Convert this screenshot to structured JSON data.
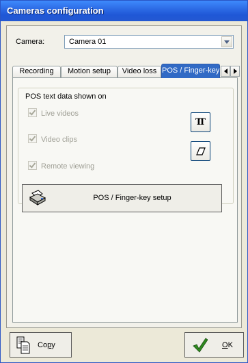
{
  "window": {
    "title": "Cameras configuration"
  },
  "camera": {
    "label": "Camera:",
    "selected": "Camera 01"
  },
  "tabs": [
    {
      "label": "Recording",
      "active": false
    },
    {
      "label": "Motion setup",
      "active": false
    },
    {
      "label": "Video loss",
      "active": false
    },
    {
      "label": "POS / Finger-key",
      "active": true
    }
  ],
  "pos_group": {
    "title": "POS text data shown on",
    "options": [
      {
        "label": "Live videos",
        "checked": true,
        "enabled": false
      },
      {
        "label": "Video clips",
        "checked": true,
        "enabled": false
      },
      {
        "label": "Remote viewing",
        "checked": true,
        "enabled": false
      }
    ],
    "font_button_glyph": "TT",
    "font_button_icon": "font-icon",
    "erase_button_icon": "eraser-icon"
  },
  "setup_button": {
    "label": "POS / Finger-key setup",
    "icon": "printer-icon"
  },
  "copy_button": {
    "label_pre": "Co",
    "label_u": "p",
    "label_post": "y",
    "icon": "copy-documents-icon"
  },
  "ok_button": {
    "label_u": "O",
    "label_post": "K",
    "icon": "checkmark-icon"
  },
  "colors": {
    "titlebar": "#2459d2",
    "active_tab": "#316ac5",
    "disabled_text": "#a0a096"
  }
}
